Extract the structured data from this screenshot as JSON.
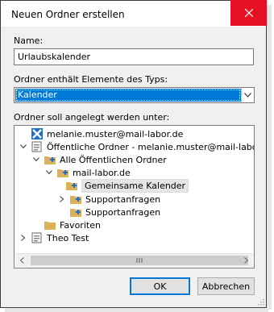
{
  "window": {
    "title": "Neuen Ordner erstellen",
    "close_glyph": "✕"
  },
  "name_field": {
    "label": "Name:",
    "value": "Urlaubskalender"
  },
  "type_field": {
    "label": "Ordner enthält Elemente des Typs:",
    "value": "Kalender"
  },
  "location": {
    "label": "Ordner soll angelegt werden unter:",
    "tree": [
      {
        "label": "melanie.muster@mail-labor.de",
        "icon": "exchange-mailbox-icon",
        "expander": "none"
      },
      {
        "label": "Öffentliche Ordner - melanie.muster@mail-labor.de",
        "icon": "public-folders-icon",
        "expander": "expanded"
      },
      {
        "label": "Alle Öffentlichen Ordner",
        "icon": "public-folder-icon",
        "expander": "expanded"
      },
      {
        "label": "mail-labor.de",
        "icon": "public-folder-icon",
        "expander": "expanded"
      },
      {
        "label": "Gemeinsame Kalender",
        "icon": "public-folder-icon",
        "expander": "none",
        "selected": true
      },
      {
        "label": "Supportanfragen",
        "icon": "public-folder-icon",
        "expander": "collapsed"
      },
      {
        "label": "Supportanfragen",
        "icon": "public-folder-icon",
        "expander": "none"
      },
      {
        "label": "Favoriten",
        "icon": "folder-icon",
        "expander": "none"
      },
      {
        "label": "Theo Test",
        "icon": "public-folders-icon",
        "expander": "collapsed"
      }
    ]
  },
  "buttons": {
    "ok": "OK",
    "cancel": "Abbrechen"
  },
  "colors": {
    "accent": "#0078d7",
    "close": "#e81123",
    "folder": "#dcb15a"
  }
}
